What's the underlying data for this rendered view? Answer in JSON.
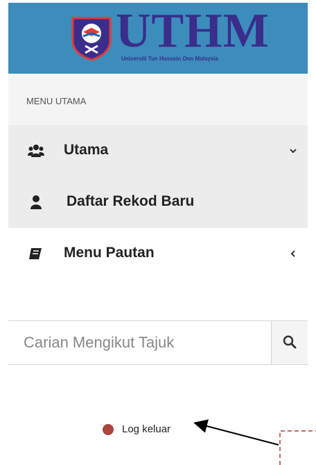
{
  "brand": {
    "wordmark": "UTHM",
    "tagline": "Universiti Tun Hussein Onn Malaysia",
    "header_color": "#3c8dbc"
  },
  "menu": {
    "header": "MENU UTAMA",
    "items": [
      {
        "label": "Utama",
        "icon": "users-icon",
        "chevron": "chevron-down-icon"
      },
      {
        "label": "Daftar Rekod Baru",
        "icon": "user-icon"
      },
      {
        "label": "Menu Pautan",
        "icon": "book-icon",
        "chevron": "chevron-left-icon"
      }
    ]
  },
  "search": {
    "placeholder": "Carian Mengikut Tajuk",
    "icon": "search-icon"
  },
  "logout": {
    "label": "Log keluar",
    "status_color": "#a9443e"
  }
}
